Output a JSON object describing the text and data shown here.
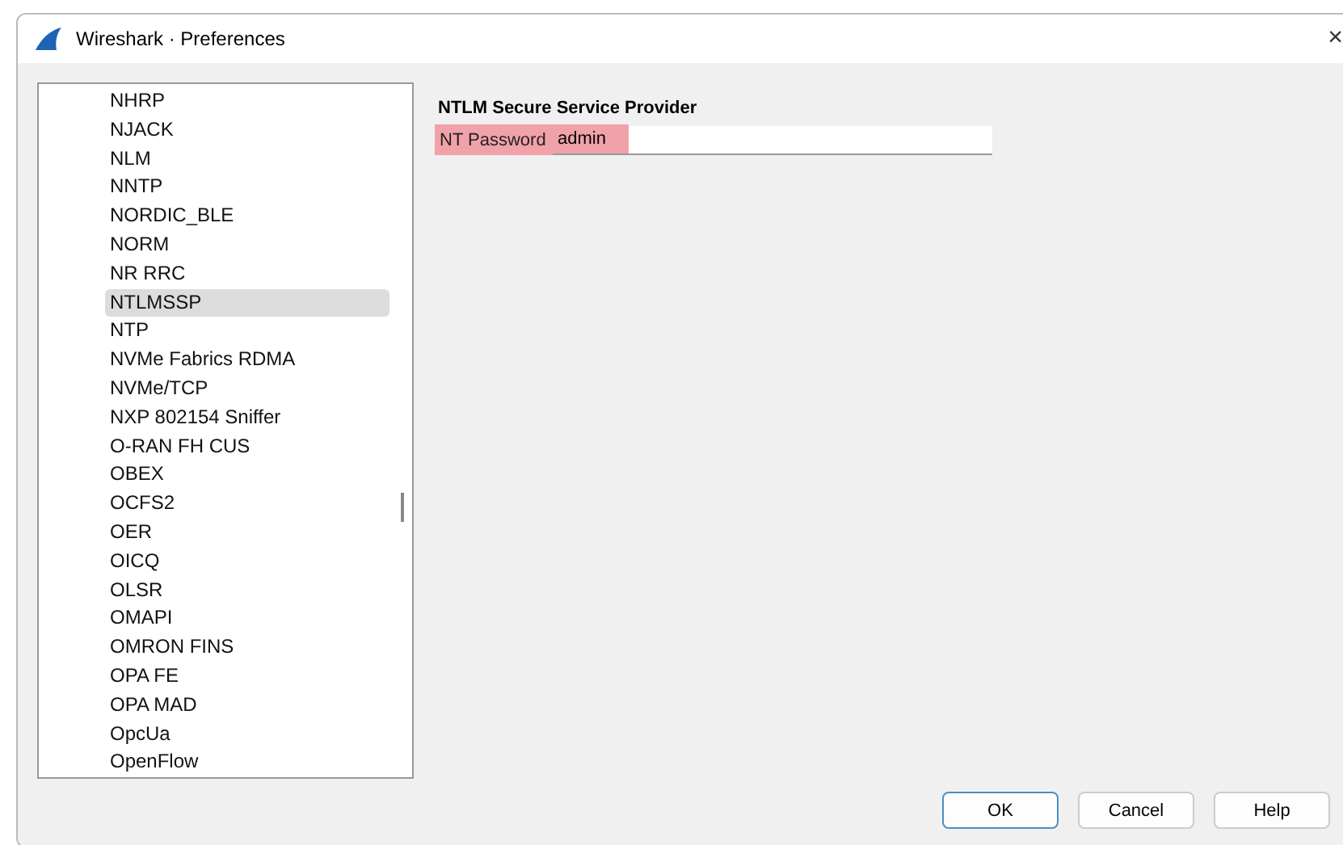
{
  "window": {
    "title": "Wireshark · Preferences",
    "close": "×"
  },
  "sidebar": {
    "items": [
      {
        "label": "NHRP",
        "selected": false
      },
      {
        "label": "NJACK",
        "selected": false
      },
      {
        "label": "NLM",
        "selected": false
      },
      {
        "label": "NNTP",
        "selected": false
      },
      {
        "label": "NORDIC_BLE",
        "selected": false
      },
      {
        "label": "NORM",
        "selected": false
      },
      {
        "label": "NR RRC",
        "selected": false
      },
      {
        "label": "NTLMSSP",
        "selected": true
      },
      {
        "label": "NTP",
        "selected": false
      },
      {
        "label": "NVMe Fabrics RDMA",
        "selected": false
      },
      {
        "label": "NVMe/TCP",
        "selected": false
      },
      {
        "label": "NXP 802154 Sniffer",
        "selected": false
      },
      {
        "label": "O-RAN FH CUS",
        "selected": false
      },
      {
        "label": "OBEX",
        "selected": false
      },
      {
        "label": "OCFS2",
        "selected": false
      },
      {
        "label": "OER",
        "selected": false
      },
      {
        "label": "OICQ",
        "selected": false
      },
      {
        "label": "OLSR",
        "selected": false
      },
      {
        "label": "OMAPI",
        "selected": false
      },
      {
        "label": "OMRON FINS",
        "selected": false
      },
      {
        "label": "OPA FE",
        "selected": false
      },
      {
        "label": "OPA MAD",
        "selected": false
      },
      {
        "label": "OpcUa",
        "selected": false
      },
      {
        "label": "OpenFlow",
        "selected": false
      }
    ]
  },
  "panel": {
    "title": "NTLM Secure Service Provider",
    "fields": [
      {
        "label": "NT Password",
        "value": "admin",
        "highlighted": true
      }
    ]
  },
  "buttons": [
    {
      "label": "OK",
      "default": true
    },
    {
      "label": "Cancel",
      "default": false
    },
    {
      "label": "Help",
      "default": false
    }
  ]
}
